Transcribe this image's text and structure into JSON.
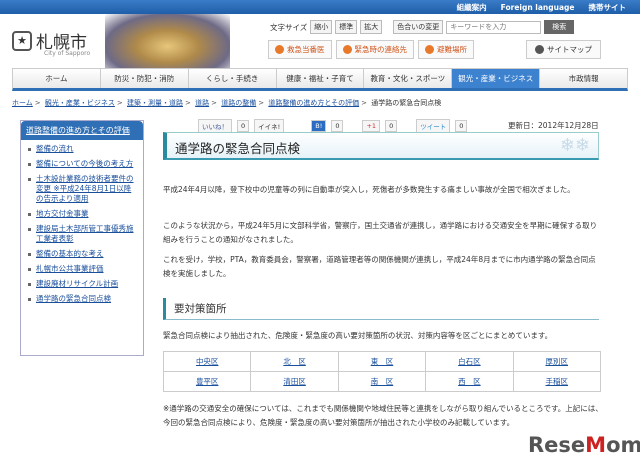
{
  "topbar": [
    "組織案内",
    "Foreign language",
    "携帯サイト"
  ],
  "logo": {
    "name": "札幌市",
    "sub": "City of Sapporo"
  },
  "tools": {
    "font_size_label": "文字サイズ",
    "small": "縮小",
    "standard": "標準",
    "large": "拡大",
    "color": "色合いの変更",
    "search_placeholder": "キーワードを入力",
    "search_button": "検索"
  },
  "emergency": [
    "救急当番医",
    "緊急時の連絡先",
    "避難場所"
  ],
  "sitemap": "サイトマップ",
  "nav": [
    "ホーム",
    "防災・防犯・消防",
    "くらし・手続き",
    "健康・福祉・子育て",
    "教育・文化・スポーツ",
    "観光・産業・ビジネス",
    "市政情報"
  ],
  "breadcrumb": [
    "ホーム",
    "観光・産業・ビジネス",
    "建築・測量・道路",
    "道路",
    "道路の整備",
    "道路整備の進め方とその評価",
    "通学路の緊急合同点検"
  ],
  "sidebar": {
    "heading": "道路整備の進め方とその評価",
    "items": [
      "整備の流れ",
      "整備についての今後の考え方",
      "土木設計業務の技術者要件の変更 ※平成24年8月1日以降の告示より適用",
      "地方交付金事業",
      "建設局土木部所管工事優秀施工業者表彰",
      "整備の基本的な考え",
      "札幌市公共事業評価",
      "建設廃材リサイクル計画",
      "通学路の緊急合同点検"
    ]
  },
  "social": {
    "like": "いいね！",
    "like_count": "0",
    "iine": "イイネ!",
    "hatena": "B!",
    "hatena_count": "0",
    "gplus": "+1",
    "gplus_count": "0",
    "tweet": "ツイート",
    "tweet_count": "0"
  },
  "updated": "更新日：2012年12月28日",
  "title": "通学路の緊急合同点検",
  "paragraphs": [
    "平成24年4月以降，登下校中の児童等の列に自動車が突入し，死傷者が多数発生する痛ましい事故が全国で相次ぎました。",
    "このような状況から，平成24年5月に文部科学省，警察庁，国土交通省が連携し，通学路における交通安全を早期に確保する取り組みを行うことの通知がなされました。",
    "これを受け，学校，PTA，教育委員会，警察署，道路管理者等の関係機関が連携し，平成24年8月までに市内通学路の緊急合同点検を実施しました。"
  ],
  "section": {
    "heading": "要対策箇所",
    "intro": "緊急合同点検により抽出された、危険度・緊急度の高い要対策箇所の状況、対策内容等を区ごとにまとめています。",
    "wards": [
      [
        "中央区",
        "北　区",
        "東　区",
        "白石区",
        "厚別区"
      ],
      [
        "豊平区",
        "清田区",
        "南　区",
        "西　区",
        "手稲区"
      ]
    ],
    "note": "※通学路の交通安全の確保については、これまでも関係機関や地域住民等と連携をしながら取り組んでいるところです。上記には、今回の緊急合同点検により、危険度・緊急度の高い要対策箇所が抽出された小学校のみ記載しています。"
  },
  "watermark": "ReseMom"
}
